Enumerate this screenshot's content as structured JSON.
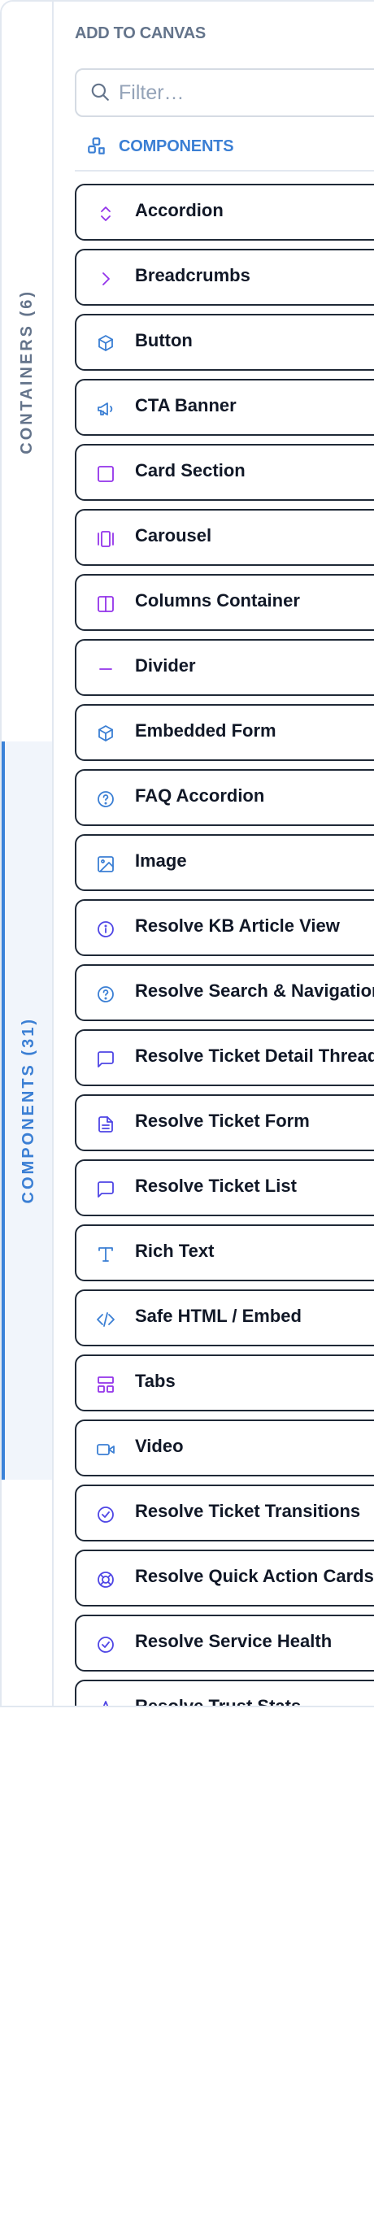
{
  "rail": {
    "containers_tab": "CONTAINERS (6)",
    "components_tab": "COMPONENTS (31)"
  },
  "header": {
    "title": "ADD TO CANVAS"
  },
  "filter": {
    "placeholder": "Filter…"
  },
  "section": {
    "label": "COMPONENTS"
  },
  "colors": {
    "accent": "#3b7fd4",
    "purple": "#9333ea",
    "indigo": "#4f46e5"
  },
  "components": [
    {
      "label": "Accordion",
      "icon": "chevrons-up-down-icon"
    },
    {
      "label": "Breadcrumbs",
      "icon": "chevron-right-icon"
    },
    {
      "label": "Button",
      "icon": "cube-icon"
    },
    {
      "label": "CTA Banner",
      "icon": "megaphone-icon"
    },
    {
      "label": "Card Section",
      "icon": "square-icon"
    },
    {
      "label": "Carousel",
      "icon": "carousel-icon"
    },
    {
      "label": "Columns Container",
      "icon": "columns-icon"
    },
    {
      "label": "Divider",
      "icon": "minus-icon"
    },
    {
      "label": "Embedded Form",
      "icon": "cube-icon"
    },
    {
      "label": "FAQ Accordion",
      "icon": "help-circle-icon"
    },
    {
      "label": "Image",
      "icon": "image-icon"
    },
    {
      "label": "Resolve KB Article View",
      "icon": "info-circle-icon"
    },
    {
      "label": "Resolve Search & Navigation",
      "icon": "help-circle-icon"
    },
    {
      "label": "Resolve Ticket Detail Thread",
      "icon": "message-square-icon"
    },
    {
      "label": "Resolve Ticket Form",
      "icon": "file-text-icon"
    },
    {
      "label": "Resolve Ticket List",
      "icon": "message-square-icon"
    },
    {
      "label": "Rich Text",
      "icon": "type-icon"
    },
    {
      "label": "Safe HTML / Embed",
      "icon": "code-icon"
    },
    {
      "label": "Tabs",
      "icon": "layout-icon"
    },
    {
      "label": "Video",
      "icon": "video-icon"
    },
    {
      "label": "Resolve Ticket Transitions",
      "icon": "check-circle-icon"
    },
    {
      "label": "Resolve Quick Action Cards",
      "icon": "life-buoy-icon"
    },
    {
      "label": "Resolve Service Health",
      "icon": "check-circle-icon"
    },
    {
      "label": "Resolve Trust Stats",
      "icon": "star-icon"
    }
  ]
}
